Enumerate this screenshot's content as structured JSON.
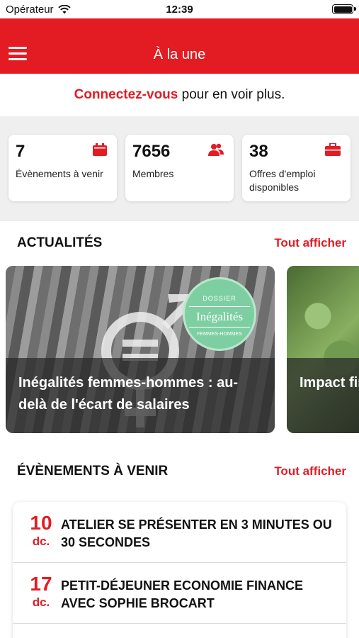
{
  "status_bar": {
    "carrier": "Opérateur",
    "time": "12:39"
  },
  "nav": {
    "title": "À la une"
  },
  "connect": {
    "link": "Connectez-vous",
    "rest": " pour en voir plus."
  },
  "stats": [
    {
      "value": "7",
      "label": "Évènements à venir",
      "icon": "calendar-icon"
    },
    {
      "value": "7656",
      "label": "Membres",
      "icon": "users-icon"
    },
    {
      "value": "38",
      "label": "Offres d'emploi disponibles",
      "icon": "briefcase-icon"
    }
  ],
  "news": {
    "heading": "ACTUALITÉS",
    "see_all": "Tout afficher",
    "items": [
      {
        "title": "Inégalités femmes-hommes : au-delà de l'écart de salaires",
        "badge_top": "DOSSIER",
        "badge_main": "Inégalités",
        "badge_bottom": "FEMMES-HOMMES"
      },
      {
        "title": "Impact finance"
      }
    ]
  },
  "events": {
    "heading": "ÉVÈNEMENTS À VENIR",
    "see_all": "Tout afficher",
    "items": [
      {
        "day": "10",
        "month": "dc.",
        "title": "ATELIER SE PRÉSENTER EN 3 MINUTES OU 30 SECONDES"
      },
      {
        "day": "17",
        "month": "dc.",
        "title": "PETIT-DÉJEUNER ECONOMIE FINANCE AVEC SOPHIE BROCART"
      }
    ]
  },
  "colors": {
    "accent": "#e31c24",
    "background": "#efefef",
    "badge": "#7dcfa2"
  }
}
